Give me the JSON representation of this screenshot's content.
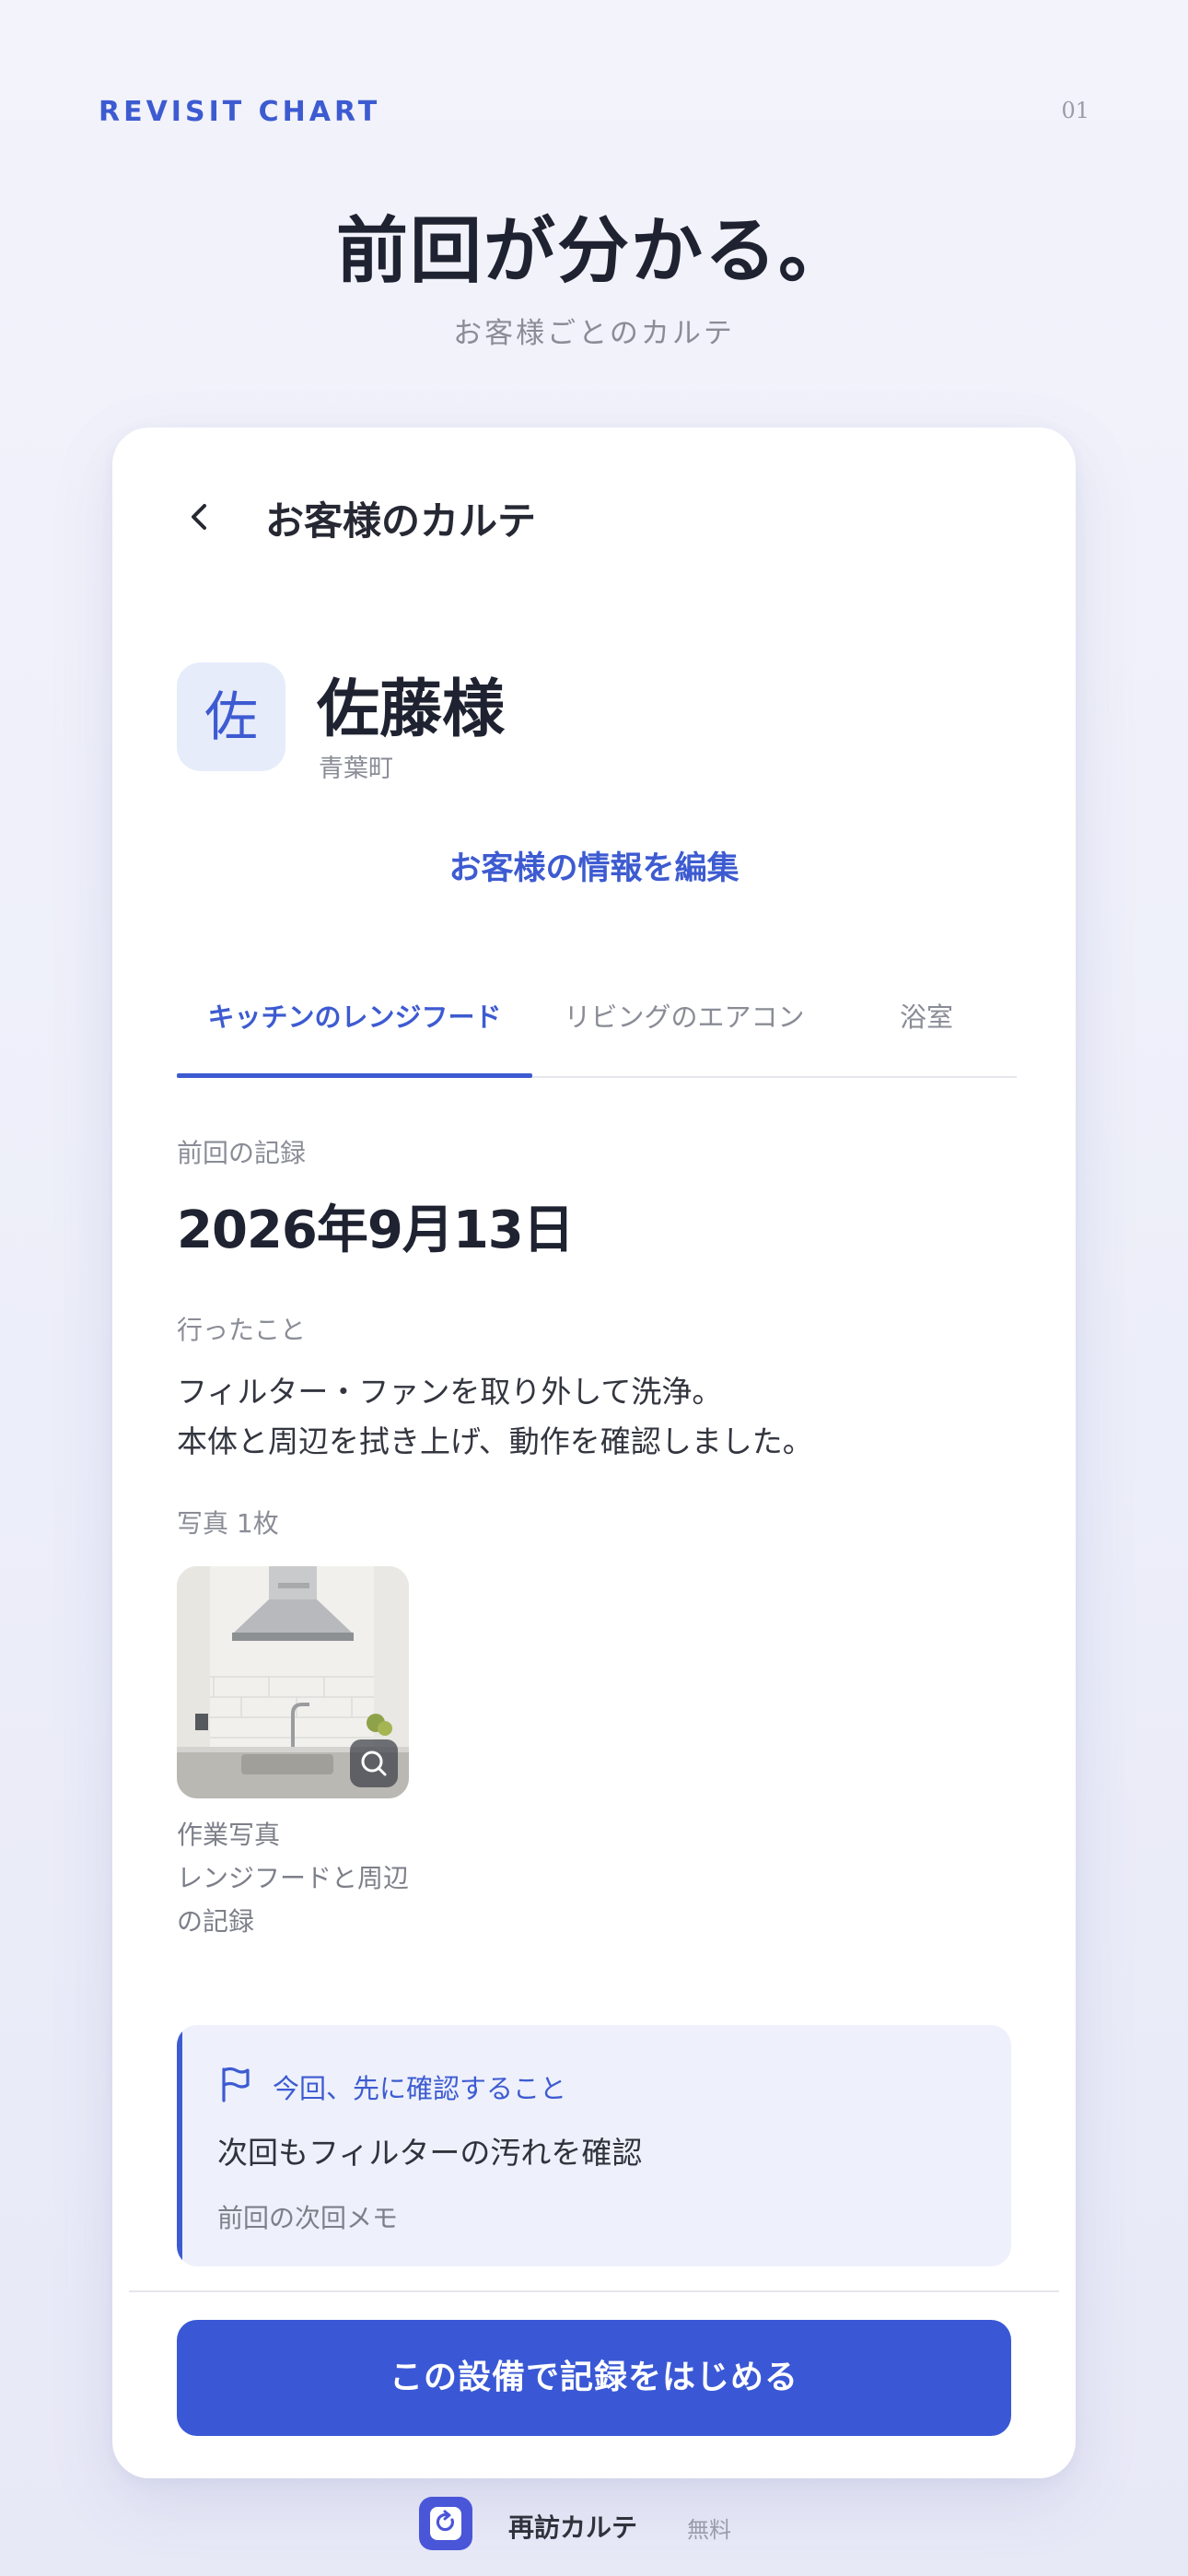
{
  "header": {
    "brand": "REVISIT CHART",
    "page_number": "01",
    "headline": "前回が分かる。",
    "subheadline": "お客様ごとのカルテ"
  },
  "screen": {
    "nav": {
      "back_icon": "chevron-left-icon",
      "title": "お客様のカルテ"
    },
    "customer": {
      "avatar_char": "佐",
      "name": "佐藤様",
      "area": "青葉町",
      "edit_label": "お客様の情報を編集"
    },
    "tabs": [
      {
        "label": "キッチンのレンジフード",
        "active": true
      },
      {
        "label": "リビングのエアコン",
        "active": false
      },
      {
        "label": "浴室",
        "active": false
      }
    ],
    "record": {
      "last_label": "前回の記録",
      "date": "2026年9月13日",
      "done_label": "行ったこと",
      "done_lines": [
        "フィルター・ファンを取り外して洗浄。",
        "本体と周辺を拭き上げ、動作を確認しました。"
      ],
      "photos_label": "写真 1枚",
      "photo_caption_lines": [
        "作業写真",
        "レンジフードと周辺",
        "の記録"
      ]
    },
    "note": {
      "icon": "flag-icon",
      "heading": "今回、先に確認すること",
      "body": "次回もフィルターの汚れを確認",
      "sub": "前回の次回メモ"
    },
    "cta_label": "この設備で記録をはじめる"
  },
  "footer": {
    "app_icon": "refresh-icon",
    "app_name": "再訪カルテ",
    "price": "無料"
  },
  "colors": {
    "accent": "#3d5bd1",
    "cta": "#3a58d6",
    "note_bg": "#eef1fc",
    "avatar_bg": "#e7ecfb",
    "page_bg": "#eff0fa"
  }
}
